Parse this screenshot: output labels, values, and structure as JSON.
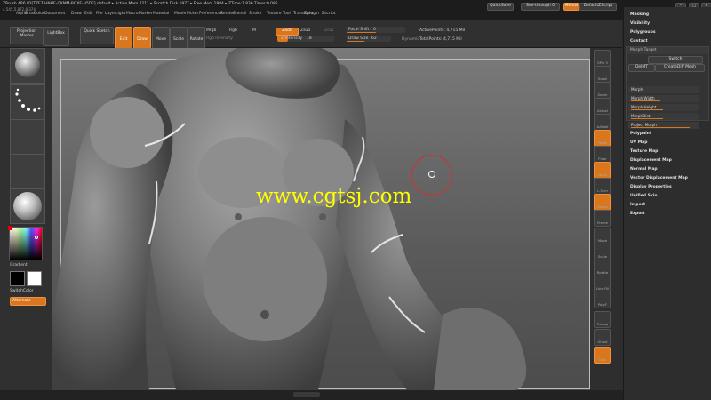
{
  "title_line": "ZBrush 4R6 P2[TZE7-HNHE-QKMM-BQXE-H5DE]   default   ▸ Active Mem 2211 ▸ Scratch Disk 1977 ▸ Free Mem 1984 ▸ ZTime:1.836 Timer:0.085",
  "top_right": {
    "quicksave": "QuickSave",
    "seethrough": "See-through 0",
    "menus": "Menus",
    "script": "DefaultZScript"
  },
  "coords": "4.545,5.872,8.374",
  "menus": [
    "Alpha",
    "Brush",
    "Color",
    "Document",
    "Draw",
    "Edit",
    "File",
    "Layer",
    "Light",
    "Macro",
    "Marker",
    "Material",
    "Movie",
    "Picker",
    "Preferences",
    "Render",
    "Stencil",
    "Stroke",
    "Texture",
    "Tool",
    "Transform",
    "Zplugin",
    "Zscript"
  ],
  "shelf": {
    "projection_master": "Projection Master",
    "lightbox": "LightBox",
    "quick_sketch": "Quick Sketch",
    "edit": "Edit",
    "draw": "Draw",
    "move": "Move",
    "scale": "Scale",
    "rotate": "Rotate",
    "mrgb": "Mrgb",
    "rgb": "Rgb",
    "m": "M",
    "rgb_intensity": "Rgb Intensity",
    "zadd": "Zadd",
    "zsub": "Zsub",
    "zcut": "Zcut",
    "z_intensity_label": "Z Intensity",
    "z_intensity": "18",
    "focal_shift_label": "Focal Shift",
    "focal_shift": "0",
    "draw_size_label": "Draw Size",
    "draw_size": "62",
    "dynamic": "Dynamic",
    "active_points": "ActivePoints: 4,715 Mil",
    "total_points": "TotalPoints: 4,715 Mil"
  },
  "left": {
    "gradient": "Gradient",
    "switch_color": "SwitchColor",
    "alternate": "Alternate",
    "primary_color": "#000000",
    "secondary_color": "#ffffff"
  },
  "watermark": "www.cgtsj.com",
  "right_shelf": [
    "SPix 3",
    "Scroll",
    "Zoom",
    "Actual",
    "AAHalf",
    "Persp",
    "Floor",
    "Local",
    "L.Sym",
    "Xpose",
    "Frame",
    "Move",
    "Scale",
    "Rotate",
    "Line Fill",
    "PolyF",
    "Transp",
    "Ghost",
    "Solo"
  ],
  "palette": {
    "headers_top": [
      "Masking",
      "Visibility",
      "Polygroups",
      "Contact"
    ],
    "morph_target": "Morph Target",
    "switch": "Switch",
    "delmt": "DelMT",
    "create_diff_mesh": "CreateDiff Mesh",
    "sliders": [
      {
        "label": "Morph",
        "value": 0.55
      },
      {
        "label": "Morph Width",
        "value": 0.45
      },
      {
        "label": "Morph Height",
        "value": 0.5
      },
      {
        "label": "MorphDist",
        "value": 0.5
      },
      {
        "label": "Project Morph",
        "value": 0.9
      }
    ],
    "headers_bottom": [
      "Polypaint",
      "UV Map",
      "Texture Map",
      "Displacement Map",
      "Normal Map",
      "Vector Displacement Map",
      "Display Properties",
      "Unified Skin",
      "Import",
      "Export"
    ]
  },
  "colors": {
    "accent": "#d9771f",
    "watermark": "#ffff00"
  }
}
